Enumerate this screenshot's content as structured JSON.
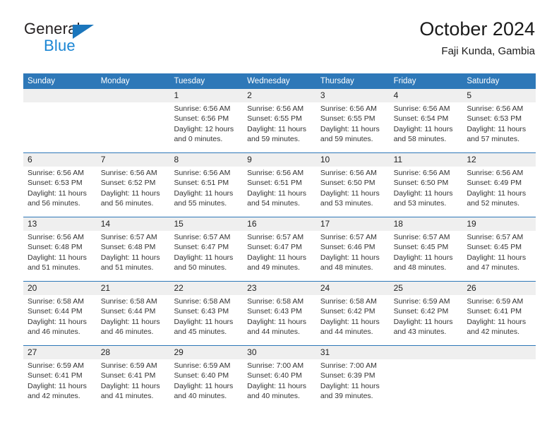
{
  "brand": {
    "word1": "General",
    "word2": "Blue",
    "accent": "#1b76bc",
    "blue_text": "#1b86d4"
  },
  "header": {
    "title": "October 2024",
    "subtitle": "Faji Kunda, Gambia"
  },
  "theme": {
    "header_blue": "#2e78b8",
    "daynum_band": "#efefef",
    "text": "#333333"
  },
  "weekdays": [
    "Sunday",
    "Monday",
    "Tuesday",
    "Wednesday",
    "Thursday",
    "Friday",
    "Saturday"
  ],
  "weeks": [
    [
      {
        "day": "",
        "lines": []
      },
      {
        "day": "",
        "lines": []
      },
      {
        "day": "1",
        "lines": [
          "Sunrise: 6:56 AM",
          "Sunset: 6:56 PM",
          "Daylight: 12 hours",
          "and 0 minutes."
        ]
      },
      {
        "day": "2",
        "lines": [
          "Sunrise: 6:56 AM",
          "Sunset: 6:55 PM",
          "Daylight: 11 hours",
          "and 59 minutes."
        ]
      },
      {
        "day": "3",
        "lines": [
          "Sunrise: 6:56 AM",
          "Sunset: 6:55 PM",
          "Daylight: 11 hours",
          "and 59 minutes."
        ]
      },
      {
        "day": "4",
        "lines": [
          "Sunrise: 6:56 AM",
          "Sunset: 6:54 PM",
          "Daylight: 11 hours",
          "and 58 minutes."
        ]
      },
      {
        "day": "5",
        "lines": [
          "Sunrise: 6:56 AM",
          "Sunset: 6:53 PM",
          "Daylight: 11 hours",
          "and 57 minutes."
        ]
      }
    ],
    [
      {
        "day": "6",
        "lines": [
          "Sunrise: 6:56 AM",
          "Sunset: 6:53 PM",
          "Daylight: 11 hours",
          "and 56 minutes."
        ]
      },
      {
        "day": "7",
        "lines": [
          "Sunrise: 6:56 AM",
          "Sunset: 6:52 PM",
          "Daylight: 11 hours",
          "and 56 minutes."
        ]
      },
      {
        "day": "8",
        "lines": [
          "Sunrise: 6:56 AM",
          "Sunset: 6:51 PM",
          "Daylight: 11 hours",
          "and 55 minutes."
        ]
      },
      {
        "day": "9",
        "lines": [
          "Sunrise: 6:56 AM",
          "Sunset: 6:51 PM",
          "Daylight: 11 hours",
          "and 54 minutes."
        ]
      },
      {
        "day": "10",
        "lines": [
          "Sunrise: 6:56 AM",
          "Sunset: 6:50 PM",
          "Daylight: 11 hours",
          "and 53 minutes."
        ]
      },
      {
        "day": "11",
        "lines": [
          "Sunrise: 6:56 AM",
          "Sunset: 6:50 PM",
          "Daylight: 11 hours",
          "and 53 minutes."
        ]
      },
      {
        "day": "12",
        "lines": [
          "Sunrise: 6:56 AM",
          "Sunset: 6:49 PM",
          "Daylight: 11 hours",
          "and 52 minutes."
        ]
      }
    ],
    [
      {
        "day": "13",
        "lines": [
          "Sunrise: 6:56 AM",
          "Sunset: 6:48 PM",
          "Daylight: 11 hours",
          "and 51 minutes."
        ]
      },
      {
        "day": "14",
        "lines": [
          "Sunrise: 6:57 AM",
          "Sunset: 6:48 PM",
          "Daylight: 11 hours",
          "and 51 minutes."
        ]
      },
      {
        "day": "15",
        "lines": [
          "Sunrise: 6:57 AM",
          "Sunset: 6:47 PM",
          "Daylight: 11 hours",
          "and 50 minutes."
        ]
      },
      {
        "day": "16",
        "lines": [
          "Sunrise: 6:57 AM",
          "Sunset: 6:47 PM",
          "Daylight: 11 hours",
          "and 49 minutes."
        ]
      },
      {
        "day": "17",
        "lines": [
          "Sunrise: 6:57 AM",
          "Sunset: 6:46 PM",
          "Daylight: 11 hours",
          "and 48 minutes."
        ]
      },
      {
        "day": "18",
        "lines": [
          "Sunrise: 6:57 AM",
          "Sunset: 6:45 PM",
          "Daylight: 11 hours",
          "and 48 minutes."
        ]
      },
      {
        "day": "19",
        "lines": [
          "Sunrise: 6:57 AM",
          "Sunset: 6:45 PM",
          "Daylight: 11 hours",
          "and 47 minutes."
        ]
      }
    ],
    [
      {
        "day": "20",
        "lines": [
          "Sunrise: 6:58 AM",
          "Sunset: 6:44 PM",
          "Daylight: 11 hours",
          "and 46 minutes."
        ]
      },
      {
        "day": "21",
        "lines": [
          "Sunrise: 6:58 AM",
          "Sunset: 6:44 PM",
          "Daylight: 11 hours",
          "and 46 minutes."
        ]
      },
      {
        "day": "22",
        "lines": [
          "Sunrise: 6:58 AM",
          "Sunset: 6:43 PM",
          "Daylight: 11 hours",
          "and 45 minutes."
        ]
      },
      {
        "day": "23",
        "lines": [
          "Sunrise: 6:58 AM",
          "Sunset: 6:43 PM",
          "Daylight: 11 hours",
          "and 44 minutes."
        ]
      },
      {
        "day": "24",
        "lines": [
          "Sunrise: 6:58 AM",
          "Sunset: 6:42 PM",
          "Daylight: 11 hours",
          "and 44 minutes."
        ]
      },
      {
        "day": "25",
        "lines": [
          "Sunrise: 6:59 AM",
          "Sunset: 6:42 PM",
          "Daylight: 11 hours",
          "and 43 minutes."
        ]
      },
      {
        "day": "26",
        "lines": [
          "Sunrise: 6:59 AM",
          "Sunset: 6:41 PM",
          "Daylight: 11 hours",
          "and 42 minutes."
        ]
      }
    ],
    [
      {
        "day": "27",
        "lines": [
          "Sunrise: 6:59 AM",
          "Sunset: 6:41 PM",
          "Daylight: 11 hours",
          "and 42 minutes."
        ]
      },
      {
        "day": "28",
        "lines": [
          "Sunrise: 6:59 AM",
          "Sunset: 6:41 PM",
          "Daylight: 11 hours",
          "and 41 minutes."
        ]
      },
      {
        "day": "29",
        "lines": [
          "Sunrise: 6:59 AM",
          "Sunset: 6:40 PM",
          "Daylight: 11 hours",
          "and 40 minutes."
        ]
      },
      {
        "day": "30",
        "lines": [
          "Sunrise: 7:00 AM",
          "Sunset: 6:40 PM",
          "Daylight: 11 hours",
          "and 40 minutes."
        ]
      },
      {
        "day": "31",
        "lines": [
          "Sunrise: 7:00 AM",
          "Sunset: 6:39 PM",
          "Daylight: 11 hours",
          "and 39 minutes."
        ]
      },
      {
        "day": "",
        "lines": []
      },
      {
        "day": "",
        "lines": []
      }
    ]
  ]
}
